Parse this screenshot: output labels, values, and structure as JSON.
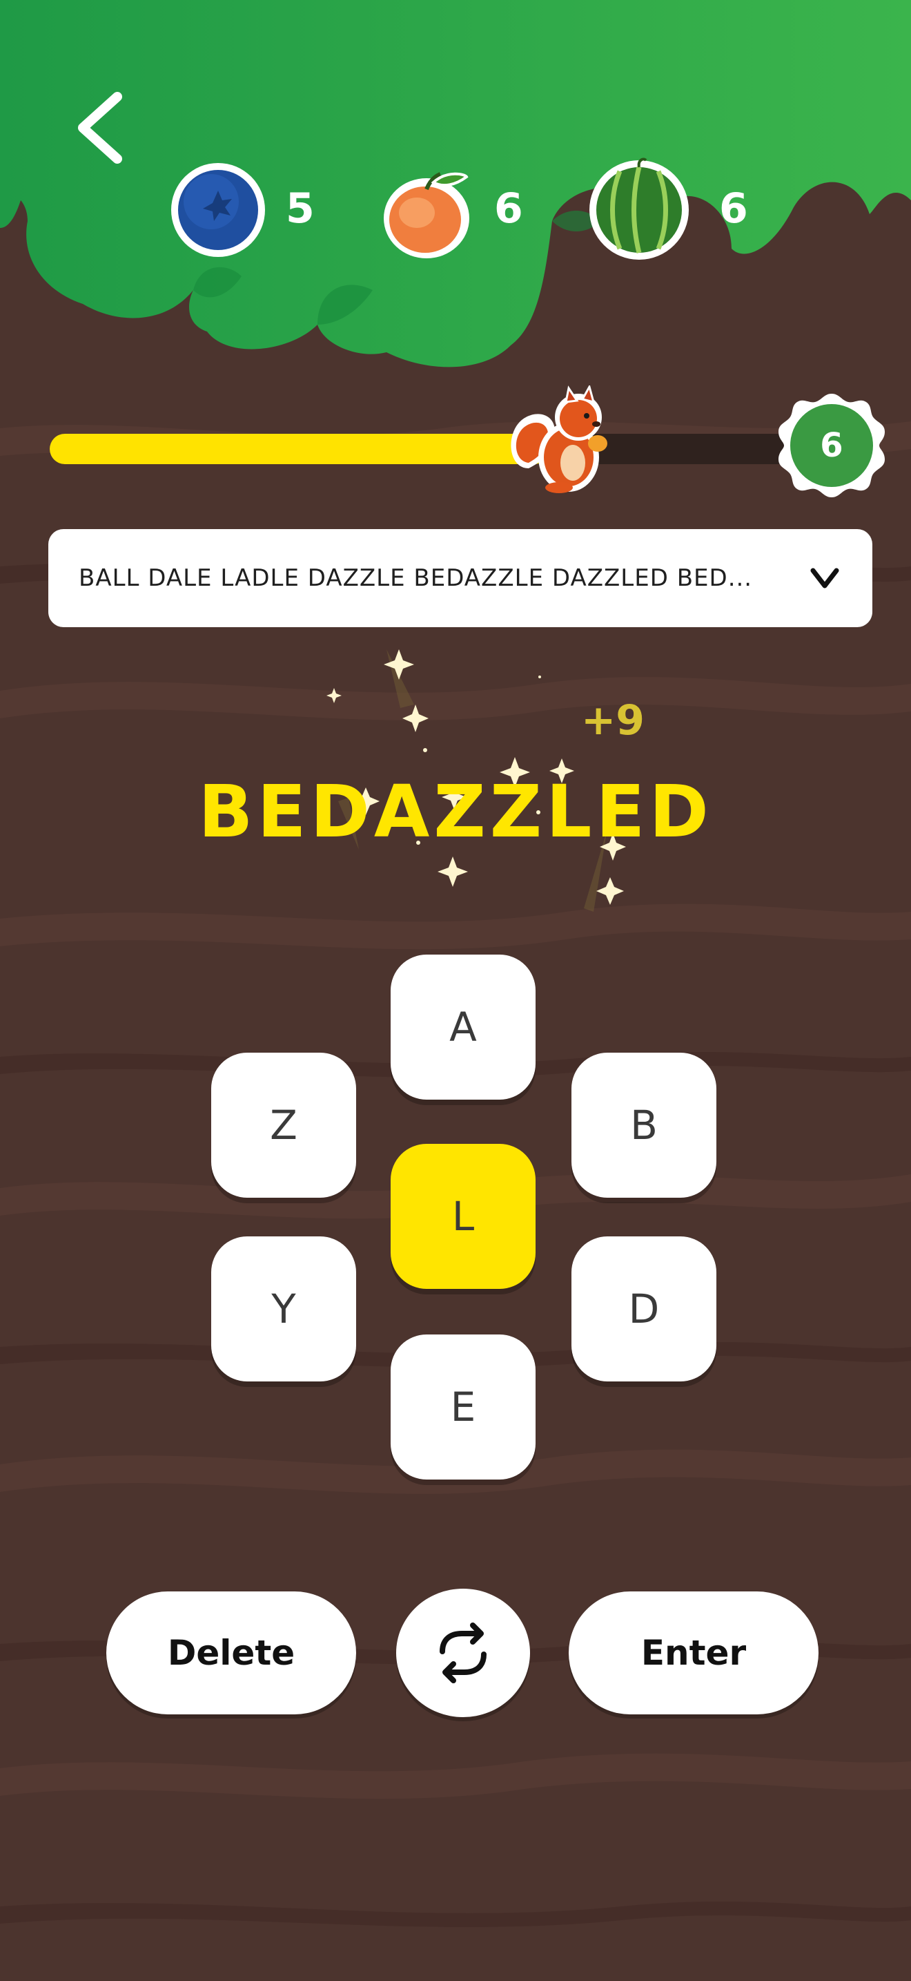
{
  "fruits": [
    {
      "name": "blueberry",
      "count": "5"
    },
    {
      "name": "peach",
      "count": "6"
    },
    {
      "name": "watermelon",
      "count": "6"
    }
  ],
  "progress": {
    "fraction": 0.67,
    "level": "6"
  },
  "found_words": "BALL DALE LADLE DAZZLE BEDAZZLE DAZZLED BED...",
  "current_word": "BEDAZZLED",
  "points": "+9",
  "letters": {
    "top": "A",
    "upper_left": "Z",
    "upper_right": "B",
    "center": "L",
    "lower_left": "Y",
    "lower_right": "D",
    "bottom": "E"
  },
  "buttons": {
    "delete": "Delete",
    "enter": "Enter"
  },
  "icons": {
    "back": "back-chevron-icon",
    "shuffle": "shuffle-icon",
    "expand": "chevron-down-icon"
  },
  "colors": {
    "canopy": "#2ea24a",
    "background": "#4c342e",
    "accent_yellow": "#ffe500",
    "badge_green": "#3a9a42"
  }
}
